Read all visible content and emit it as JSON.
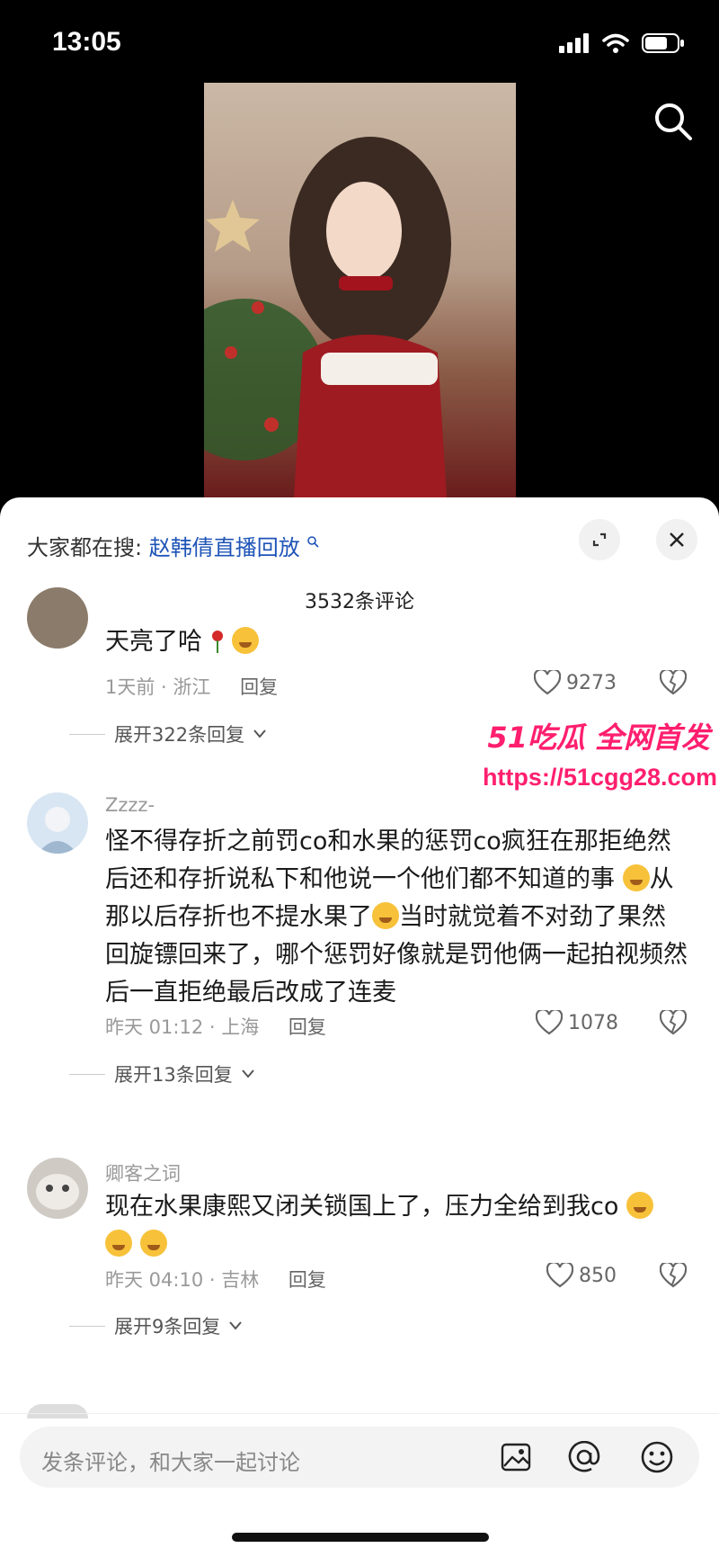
{
  "status": {
    "time": "13:05"
  },
  "search_bar": {
    "prefix": "大家都在搜:",
    "query": "赵韩倩直播回放"
  },
  "comments_header": {
    "count": "3532条评论"
  },
  "comments": [
    {
      "username": "",
      "text": "天亮了哈",
      "meta": "1天前 · 浙江",
      "reply": "回复",
      "likes": "9273",
      "expand": "展开322条回复"
    },
    {
      "username": "Zzzz-",
      "text": "怪不得存折之前罚co和水果的惩罚co疯狂在那拒绝然后还和存折说私下和他说一个他们都不知道的事",
      "text2": "从那以后存折也不提水果了",
      "text3": "当时就觉着不对劲了果然回旋镖回来了，哪个惩罚好像就是罚他俩一起拍视频然后一直拒绝最后改成了连麦",
      "meta": "昨天 01:12 · 上海",
      "reply": "回复",
      "likes": "1078",
      "expand": "展开13条回复"
    },
    {
      "username": "卿客之词",
      "text": "现在水果康熙又闭关锁国上了，压力全给到我co",
      "meta": "昨天 04:10 · 吉林",
      "reply": "回复",
      "likes": "850",
      "expand": "展开9条回复"
    }
  ],
  "watermark": {
    "brand": "51吃瓜 全网首发",
    "url": "https://51cgg28.com"
  },
  "input": {
    "placeholder": "发条评论，和大家一起讨论"
  },
  "colors": {
    "link": "#1e54b7",
    "watermark": "#ff1f6e"
  }
}
